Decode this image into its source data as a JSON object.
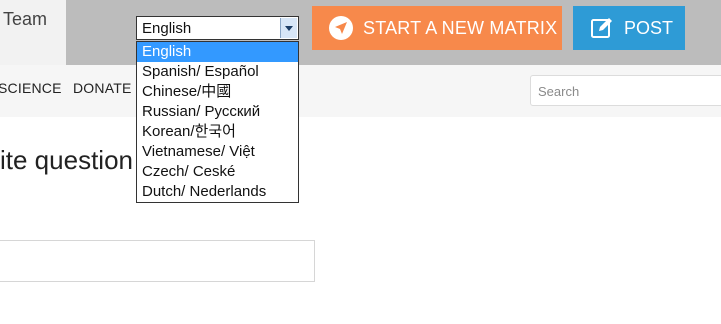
{
  "header": {
    "brand_text": "Team",
    "language_select": {
      "selected": "English",
      "options": [
        "English",
        "Spanish/ Español",
        "Chinese/中國",
        "Russian/ Русский",
        "Korean/한국어",
        "Vietnamese/ Việt",
        "Czech/ Ceské",
        "Dutch/ Nederlands"
      ],
      "highlighted_index": 0
    },
    "start_matrix_button": {
      "label": "START A NEW MATRIX",
      "color": "#f7894b",
      "icon": "navigation-arrow-icon"
    },
    "post_button": {
      "label": "POST",
      "color": "#2e9bd6",
      "icon": "edit-icon"
    }
  },
  "nav": {
    "items": [
      "SCIENCE",
      "DONATE"
    ],
    "search": {
      "placeholder": "Search"
    }
  },
  "main": {
    "heading": "ite question"
  }
}
